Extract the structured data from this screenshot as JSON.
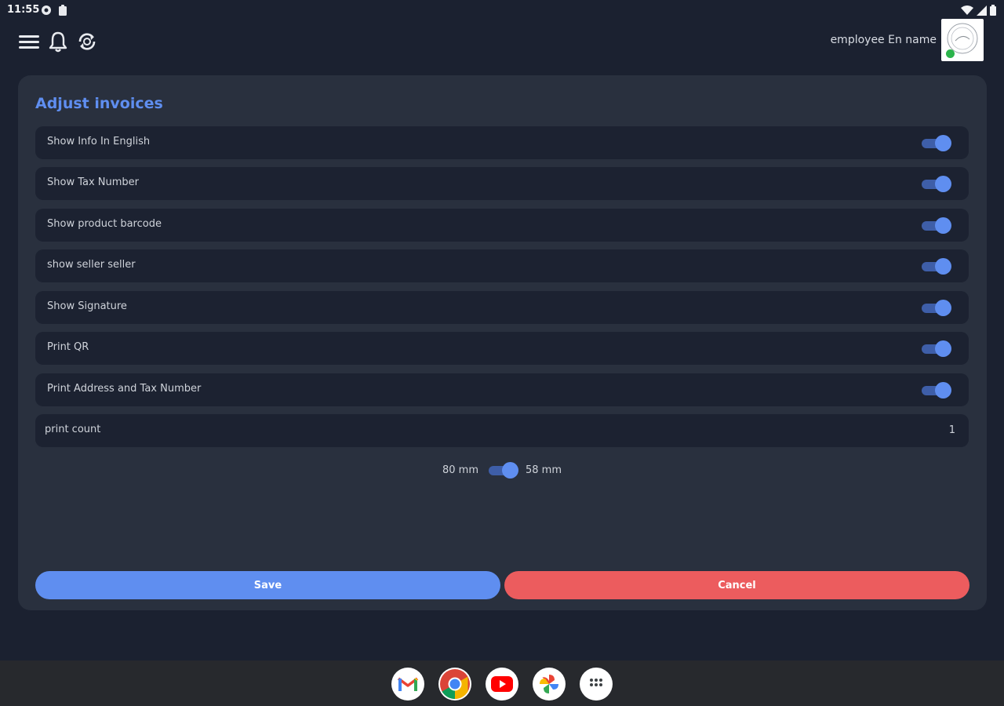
{
  "status_bar": {
    "time": "11:55",
    "left_icons": [
      "settings-status-icon",
      "clipboard-status-icon"
    ],
    "right_icons": [
      "wifi-icon",
      "signal-icon",
      "battery-icon"
    ]
  },
  "header": {
    "employee_name": "employee En name",
    "icons": [
      "menu-icon",
      "bell-icon",
      "sync-icon"
    ]
  },
  "panel": {
    "title": "Adjust invoices",
    "settings": [
      {
        "label": "Show Info In English",
        "enabled": true
      },
      {
        "label": "Show Tax Number",
        "enabled": true
      },
      {
        "label": "Show product barcode",
        "enabled": true
      },
      {
        "label": "show seller seller",
        "enabled": true
      },
      {
        "label": "Show Signature",
        "enabled": true
      },
      {
        "label": "Print QR",
        "enabled": true
      },
      {
        "label": "Print Address and Tax Number",
        "enabled": true
      }
    ],
    "print_count": {
      "label": "print count",
      "value": "1"
    },
    "paper_size": {
      "left_label": "80 mm",
      "right_label": "58 mm",
      "selected": "58 mm"
    },
    "save_label": "Save",
    "cancel_label": "Cancel"
  },
  "colors": {
    "accent": "#5f8ef0",
    "cancel": "#ec5c5e",
    "background": "#1b2130",
    "panel": "#29303e"
  },
  "dock": [
    "gmail-icon",
    "chrome-icon",
    "youtube-icon",
    "photos-icon",
    "app-drawer-icon"
  ]
}
